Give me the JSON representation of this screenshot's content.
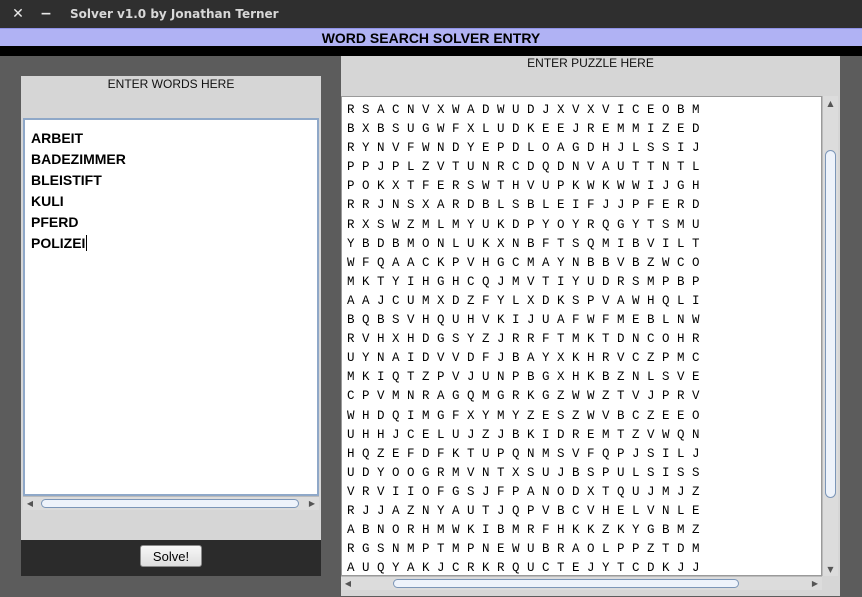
{
  "window": {
    "title": "Solver v1.0 by Jonathan Terner",
    "close_glyph": "✕",
    "minimize_glyph": "−"
  },
  "header": {
    "title": "WORD SEARCH SOLVER ENTRY"
  },
  "words_panel": {
    "label": "ENTER WORDS HERE",
    "words": [
      "ARBEIT",
      "BADEZIMMER",
      "BLEISTIFT",
      "KULI",
      "PFERD",
      "POLIZEI"
    ]
  },
  "puzzle_panel": {
    "label": "ENTER PUZZLE HERE",
    "rows": [
      "R S A C N V X W A D W U D J X V X V I C E O B M",
      "B X B S U G W F X L U D K E E J R E M M I Z E D",
      "R Y N V F W N D Y E P D L O A G D H J L S S I J",
      "P P J P L Z V T U N R C D Q D N V A U T T N T L",
      "P O K X T F E R S W T H V U P K W K W W I J G H",
      "R R J N S X A R D B L S B L E I F J J P F E R D",
      "R X S W Z M L M Y U K D P Y O Y R Q G Y T S M U",
      "Y B D B M O N L U K X N B F T S Q M I B V I L T",
      "W F Q A A C K P V H G C M A Y N B B V B Z W C O",
      "M K T Y I H G H C Q J M V T I Y U D R S M P B P",
      "A A J C U M X D Z F Y L X D K S P V A W H Q L I",
      "B Q B S V H Q U H V K I J U A F W F M E B L N W",
      "R V H X H D G S Y Z J R R F T M K T D N C O H R",
      "U Y N A I D V V D F J B A Y X K H R V C Z P M C",
      "M K I Q T Z P V J U N P B G X H K B Z N L S V E",
      "C P V M N R A G Q M G R K G Z W W Z T V J P R V",
      "W H D Q I M G F X Y M Y Z E S Z W V B C Z E E O",
      "U H H J C E L U J Z J B K I D R E M T Z V W Q N",
      "H Q Z E F D F K T U P Q N M S V F Q P J S I L J",
      "U D Y O O G R M V N T X S U J B S P U L S I S S",
      "V R V I I O F G S J F P A N O D X T Q U J M J Z",
      "R J J A Z N Y A U T J Q P V B C V H E L V N L E",
      "A B N O R H M W K I B M R F H K K Z K Y G B M Z",
      "R G S N M P T M P N E W U B R A O L P P Z T D M",
      "A U Q Y A K J C R K R Q U C T E J Y T C D K J J"
    ]
  },
  "actions": {
    "solve_label": "Solve!"
  },
  "scrollbars": {
    "left_glyph": "◀",
    "right_glyph": "▶",
    "up_glyph": "▲",
    "down_glyph": "▼"
  },
  "colors": {
    "header_band": "#b0b2f4",
    "titlebar": "#2f2f2f",
    "panel": "#d6d6d6"
  }
}
